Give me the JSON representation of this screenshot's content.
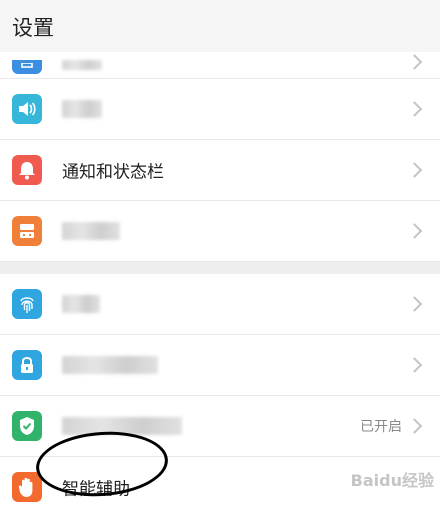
{
  "header": {
    "title": "设置"
  },
  "items": {
    "notifications": {
      "label": "通知和状态栏"
    },
    "security": {
      "status": "已开启"
    },
    "assist": {
      "label": "智能辅助"
    }
  },
  "colors": {
    "blue": "#3a8fe0",
    "teal": "#36b6d9",
    "red": "#f05a4f",
    "orange": "#f07f3a",
    "cyan": "#2fa6e0",
    "green": "#31b36b",
    "orange_hand": "#f26a2d"
  },
  "icons": [
    "display-icon",
    "speaker-icon",
    "bell-icon",
    "app-icon",
    "fingerprint-icon",
    "lock-icon",
    "shield-check-icon",
    "hand-icon"
  ],
  "watermark": {
    "text": "Baidu经验"
  }
}
